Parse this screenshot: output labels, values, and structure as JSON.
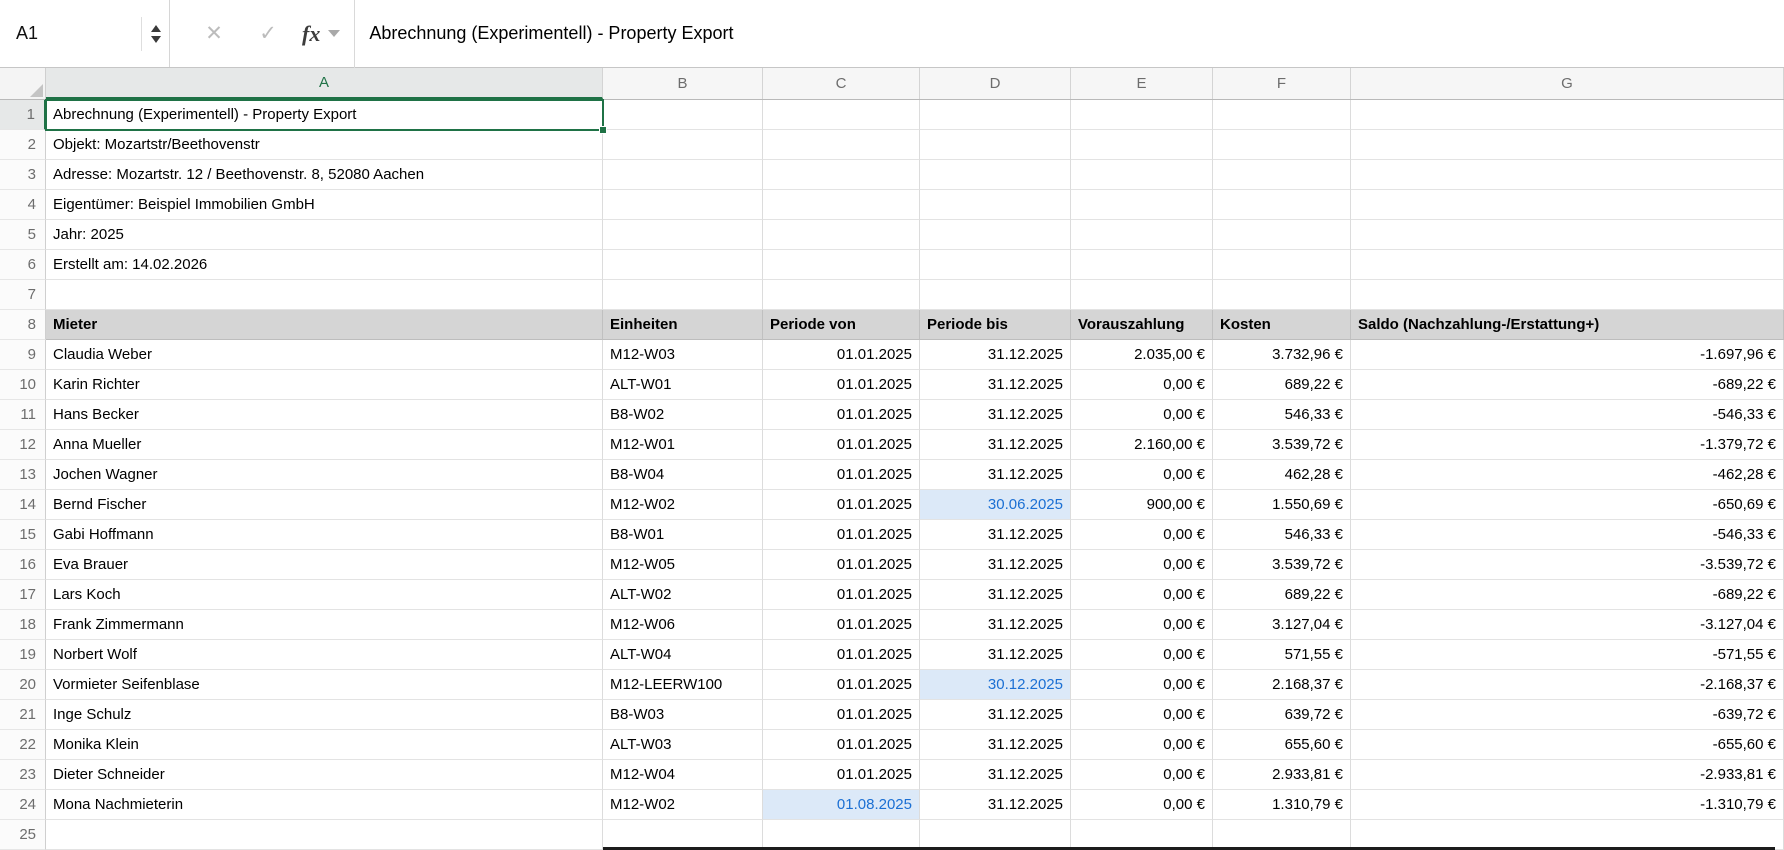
{
  "formula_bar": {
    "cell_reference": "A1",
    "fx_label": "fx",
    "formula": "Abrechnung (Experimentell) - Property Export"
  },
  "columns": [
    "A",
    "B",
    "C",
    "D",
    "E",
    "F",
    "G"
  ],
  "selection": {
    "cell": "A1",
    "column": "A",
    "row": 1
  },
  "info_rows": [
    "Abrechnung (Experimentell) - Property Export",
    "Objekt: Mozartstr/Beethovenstr",
    "Adresse: Mozartstr. 12 / Beethovenstr. 8, 52080 Aachen",
    "Eigentümer: Beispiel Immobilien GmbH",
    "Jahr: 2025",
    "Erstellt am: 14.02.2026"
  ],
  "table": {
    "header_row_number": 8,
    "first_data_row_number": 9,
    "headers": [
      "Mieter",
      "Einheiten",
      "Periode von",
      "Periode bis",
      "Vorauszahlung",
      "Kosten",
      "Saldo (Nachzahlung-/Erstattung+)"
    ],
    "rows": [
      {
        "mieter": "Claudia Weber",
        "einheiten": "M12-W03",
        "periode_von": "01.01.2025",
        "periode_bis": "31.12.2025",
        "vorauszahlung": "2.035,00 €",
        "kosten": "3.732,96 €",
        "saldo": "-1.697,96 €",
        "highlight": ""
      },
      {
        "mieter": "Karin Richter",
        "einheiten": "ALT-W01",
        "periode_von": "01.01.2025",
        "periode_bis": "31.12.2025",
        "vorauszahlung": "0,00 €",
        "kosten": "689,22 €",
        "saldo": "-689,22 €",
        "highlight": ""
      },
      {
        "mieter": "Hans Becker",
        "einheiten": "B8-W02",
        "periode_von": "01.01.2025",
        "periode_bis": "31.12.2025",
        "vorauszahlung": "0,00 €",
        "kosten": "546,33 €",
        "saldo": "-546,33 €",
        "highlight": ""
      },
      {
        "mieter": "Anna Mueller",
        "einheiten": "M12-W01",
        "periode_von": "01.01.2025",
        "periode_bis": "31.12.2025",
        "vorauszahlung": "2.160,00 €",
        "kosten": "3.539,72 €",
        "saldo": "-1.379,72 €",
        "highlight": ""
      },
      {
        "mieter": "Jochen Wagner",
        "einheiten": "B8-W04",
        "periode_von": "01.01.2025",
        "periode_bis": "31.12.2025",
        "vorauszahlung": "0,00 €",
        "kosten": "462,28 €",
        "saldo": "-462,28 €",
        "highlight": ""
      },
      {
        "mieter": "Bernd Fischer",
        "einheiten": "M12-W02",
        "periode_von": "01.01.2025",
        "periode_bis": "30.06.2025",
        "vorauszahlung": "900,00 €",
        "kosten": "1.550,69 €",
        "saldo": "-650,69 €",
        "highlight": "periode_bis"
      },
      {
        "mieter": "Gabi Hoffmann",
        "einheiten": "B8-W01",
        "periode_von": "01.01.2025",
        "periode_bis": "31.12.2025",
        "vorauszahlung": "0,00 €",
        "kosten": "546,33 €",
        "saldo": "-546,33 €",
        "highlight": ""
      },
      {
        "mieter": "Eva Brauer",
        "einheiten": "M12-W05",
        "periode_von": "01.01.2025",
        "periode_bis": "31.12.2025",
        "vorauszahlung": "0,00 €",
        "kosten": "3.539,72 €",
        "saldo": "-3.539,72 €",
        "highlight": ""
      },
      {
        "mieter": "Lars Koch",
        "einheiten": "ALT-W02",
        "periode_von": "01.01.2025",
        "periode_bis": "31.12.2025",
        "vorauszahlung": "0,00 €",
        "kosten": "689,22 €",
        "saldo": "-689,22 €",
        "highlight": ""
      },
      {
        "mieter": "Frank Zimmermann",
        "einheiten": "M12-W06",
        "periode_von": "01.01.2025",
        "periode_bis": "31.12.2025",
        "vorauszahlung": "0,00 €",
        "kosten": "3.127,04 €",
        "saldo": "-3.127,04 €",
        "highlight": ""
      },
      {
        "mieter": "Norbert Wolf",
        "einheiten": "ALT-W04",
        "periode_von": "01.01.2025",
        "periode_bis": "31.12.2025",
        "vorauszahlung": "0,00 €",
        "kosten": "571,55 €",
        "saldo": "-571,55 €",
        "highlight": ""
      },
      {
        "mieter": "Vormieter Seifenblase",
        "einheiten": "M12-LEERW100",
        "periode_von": "01.01.2025",
        "periode_bis": "30.12.2025",
        "vorauszahlung": "0,00 €",
        "kosten": "2.168,37 €",
        "saldo": "-2.168,37 €",
        "highlight": "periode_bis"
      },
      {
        "mieter": "Inge Schulz",
        "einheiten": "B8-W03",
        "periode_von": "01.01.2025",
        "periode_bis": "31.12.2025",
        "vorauszahlung": "0,00 €",
        "kosten": "639,72 €",
        "saldo": "-639,72 €",
        "highlight": ""
      },
      {
        "mieter": "Monika Klein",
        "einheiten": "ALT-W03",
        "periode_von": "01.01.2025",
        "periode_bis": "31.12.2025",
        "vorauszahlung": "0,00 €",
        "kosten": "655,60 €",
        "saldo": "-655,60 €",
        "highlight": ""
      },
      {
        "mieter": "Dieter Schneider",
        "einheiten": "M12-W04",
        "periode_von": "01.01.2025",
        "periode_bis": "31.12.2025",
        "vorauszahlung": "0,00 €",
        "kosten": "2.933,81 €",
        "saldo": "-2.933,81 €",
        "highlight": ""
      },
      {
        "mieter": "Mona Nachmieterin",
        "einheiten": "M12-W02",
        "periode_von": "01.08.2025",
        "periode_bis": "31.12.2025",
        "vorauszahlung": "0,00 €",
        "kosten": "1.310,79 €",
        "saldo": "-1.310,79 €",
        "highlight": "periode_von"
      }
    ]
  },
  "colors": {
    "selection_green": "#1f7246",
    "highlight_cell_bg": "#dce9f8",
    "highlight_cell_text": "#1b6fd3",
    "table_header_bg": "#d5d5d5"
  }
}
